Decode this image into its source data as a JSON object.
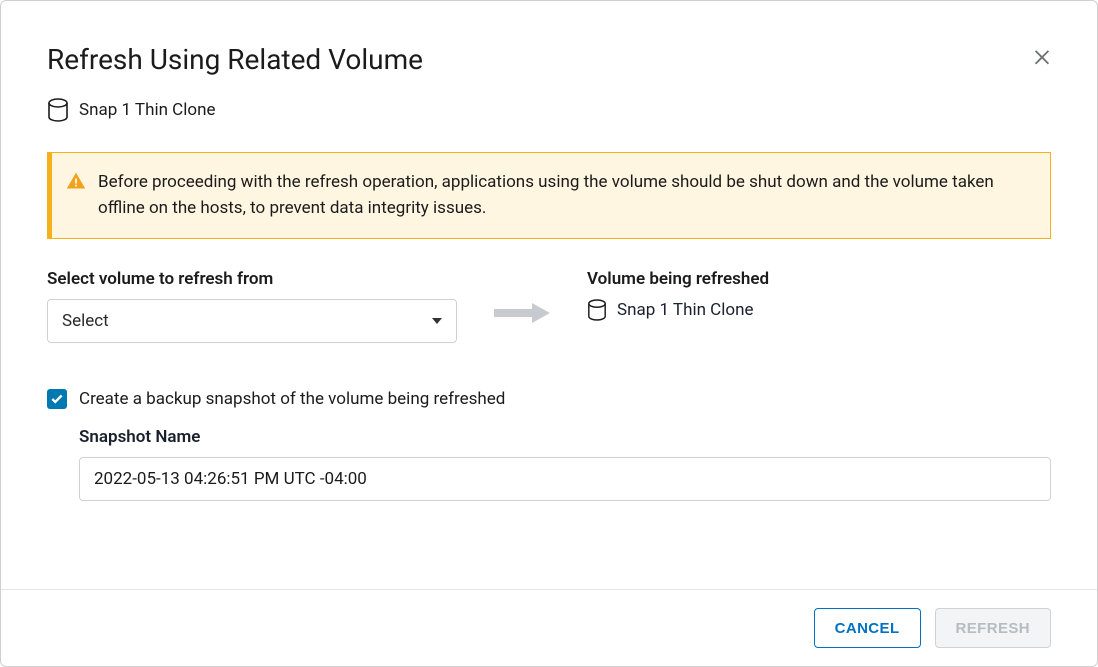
{
  "dialog": {
    "title": "Refresh Using Related Volume",
    "volume_name": "Snap 1 Thin Clone"
  },
  "alert": {
    "text": "Before proceeding with the refresh operation, applications using the volume should be shut down and the volume taken offline on the hosts, to prevent data integrity issues."
  },
  "select_source": {
    "label": "Select volume to refresh from",
    "value": "Select"
  },
  "target": {
    "label": "Volume being refreshed",
    "value": "Snap 1 Thin Clone"
  },
  "backup": {
    "checkbox_label": "Create a backup snapshot of the volume being refreshed",
    "checked": true,
    "snapshot_label": "Snapshot Name",
    "snapshot_value": "2022-05-13 04:26:51 PM UTC -04:00"
  },
  "footer": {
    "cancel": "CANCEL",
    "refresh": "REFRESH"
  }
}
